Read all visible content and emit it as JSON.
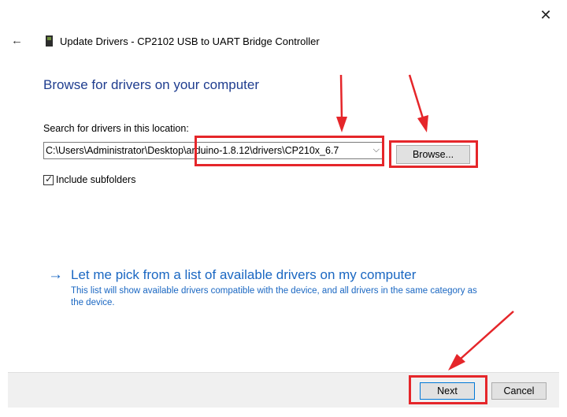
{
  "window": {
    "close_glyph": "✕",
    "back_glyph": "←",
    "title": "Update Drivers - CP2102 USB to UART Bridge Controller",
    "device_icon": "usb-device-icon"
  },
  "main": {
    "heading": "Browse for drivers on your computer",
    "search_label": "Search for drivers in this location:",
    "path_value": "C:\\Users\\Administrator\\Desktop\\arduino-1.8.12\\drivers\\CP210x_6.7",
    "dropdown_glyph": "⌵",
    "browse_label": "Browse...",
    "include_subfolders": {
      "label": "Include subfolders",
      "checked": true,
      "check_glyph": "✓"
    },
    "pick_link": {
      "arrow_glyph": "→",
      "label": "Let me pick from a list of available drivers on my computer",
      "description": "This list will show available drivers compatible with the device, and all drivers in the same category as the device."
    }
  },
  "footer": {
    "next_label": "Next",
    "cancel_label": "Cancel"
  },
  "colors": {
    "heading": "#1f3d8f",
    "link": "#1a67c2",
    "annotation": "#e5262a"
  }
}
